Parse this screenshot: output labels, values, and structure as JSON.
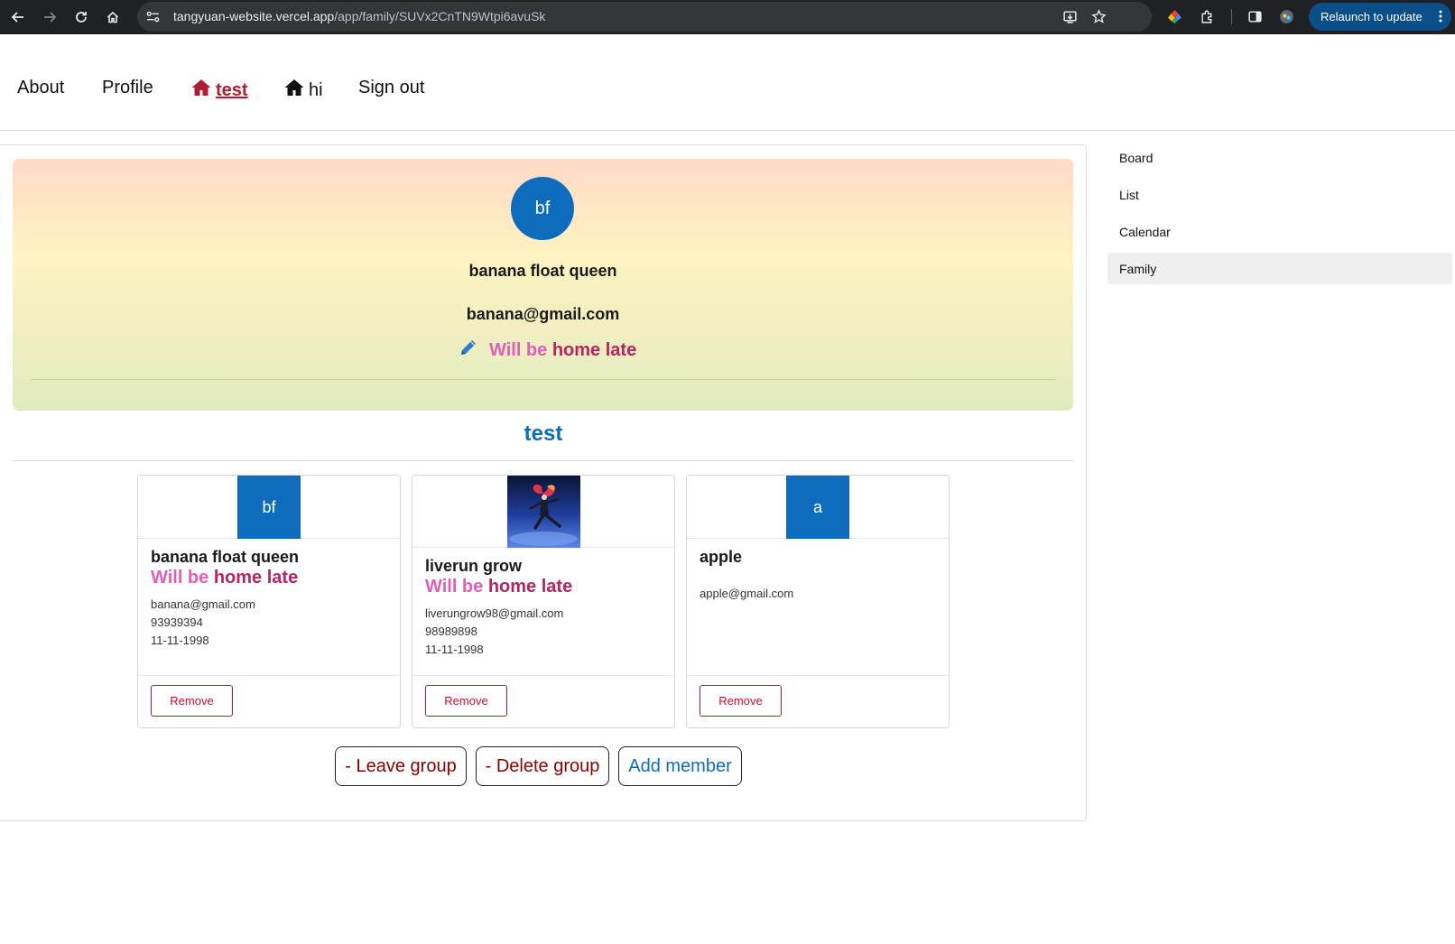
{
  "browser": {
    "url_host": "tangyuan-website.vercel.app",
    "url_path": "/app/family/SUVx2CnTN9Wtpi6avuSk",
    "relaunch_label": "Relaunch to update",
    "icons": [
      "back-icon",
      "forward-icon",
      "reload-icon",
      "home-icon",
      "site-info-icon",
      "install-icon",
      "bookmark-star-icon",
      "color-extension-icon",
      "extensions-puzzle-icon",
      "side-panel-icon",
      "profile-avatar-icon",
      "more-vert-icon"
    ]
  },
  "nav": {
    "about": "About",
    "profile": "Profile",
    "group_active": "test",
    "group_other": "hi",
    "sign_out": "Sign out"
  },
  "hero": {
    "initials": "bf",
    "name": "banana float queen",
    "email": "banana@gmail.com",
    "status_part1": "Will be",
    "status_part2": "home late"
  },
  "group": {
    "title": "test"
  },
  "members": [
    {
      "initials": "bf",
      "name": "banana float queen",
      "status_part1": "Will be",
      "status_part2": "home late",
      "email": "banana@gmail.com",
      "phone": "93939394",
      "birthday": "11-11-1998",
      "remove_label": "Remove"
    },
    {
      "initials": "",
      "name": "liverun grow",
      "status_part1": "Will be",
      "status_part2": "home late",
      "email": "liverungrow98@gmail.com",
      "phone": "98989898",
      "birthday": "11-11-1998",
      "remove_label": "Remove"
    },
    {
      "initials": "a",
      "name": "apple",
      "email": "apple@gmail.com",
      "remove_label": "Remove"
    }
  ],
  "actions": {
    "leave": "- Leave group",
    "delete": "- Delete group",
    "add": "Add member"
  },
  "sidebar": {
    "items": [
      {
        "label": "Board"
      },
      {
        "label": "List"
      },
      {
        "label": "Calendar"
      },
      {
        "label": "Family"
      }
    ],
    "active": "Family"
  },
  "colors": {
    "brand_blue": "#0f6cbd",
    "active_nav_red": "#b11d30",
    "status_pink": "#e05fb8",
    "status_magenta": "#b32563",
    "danger_red": "#c8102e"
  }
}
